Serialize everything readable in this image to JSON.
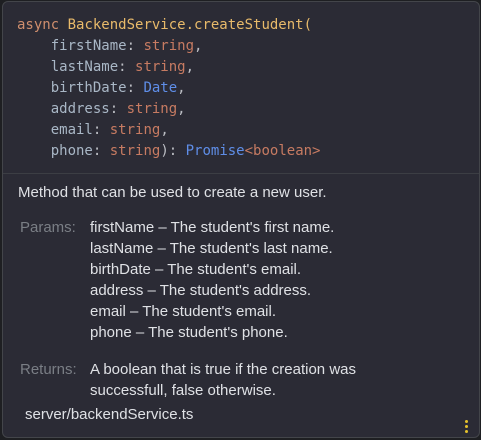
{
  "signature": {
    "async": "async",
    "function_name": "BackendService.createStudent",
    "open_paren": "(",
    "params": [
      {
        "name": "firstName",
        "type": "string",
        "suffix": ","
      },
      {
        "name": "lastName",
        "type": "string",
        "suffix": ","
      },
      {
        "name": "birthDate",
        "type": "Date",
        "suffix": ","
      },
      {
        "name": "address",
        "type": "string",
        "suffix": ","
      },
      {
        "name": "email",
        "type": "string",
        "suffix": ","
      },
      {
        "name": "phone",
        "type": "string",
        "suffix": "):"
      }
    ],
    "return_type": "Promise",
    "return_generic": "<boolean>"
  },
  "description": "Method that can be used to create a new user.",
  "params_label": "Params:",
  "params_doc": [
    "firstName – The student's first name.",
    "lastName – The student's last name.",
    "birthDate – The student's email.",
    "address – The student's address.",
    "email – The student's email.",
    "phone – The student's phone."
  ],
  "returns_label": "Returns:",
  "returns_doc": [
    "A boolean that is true if the creation was",
    "successfull, false otherwise."
  ],
  "file_path": "server/backendService.ts",
  "colors": {
    "keyword": "#cf8e6d",
    "function": "#e8ba6a",
    "type": "#5f8ee8",
    "string_type": "#c77b62",
    "more_icon": "#e5c22c"
  }
}
